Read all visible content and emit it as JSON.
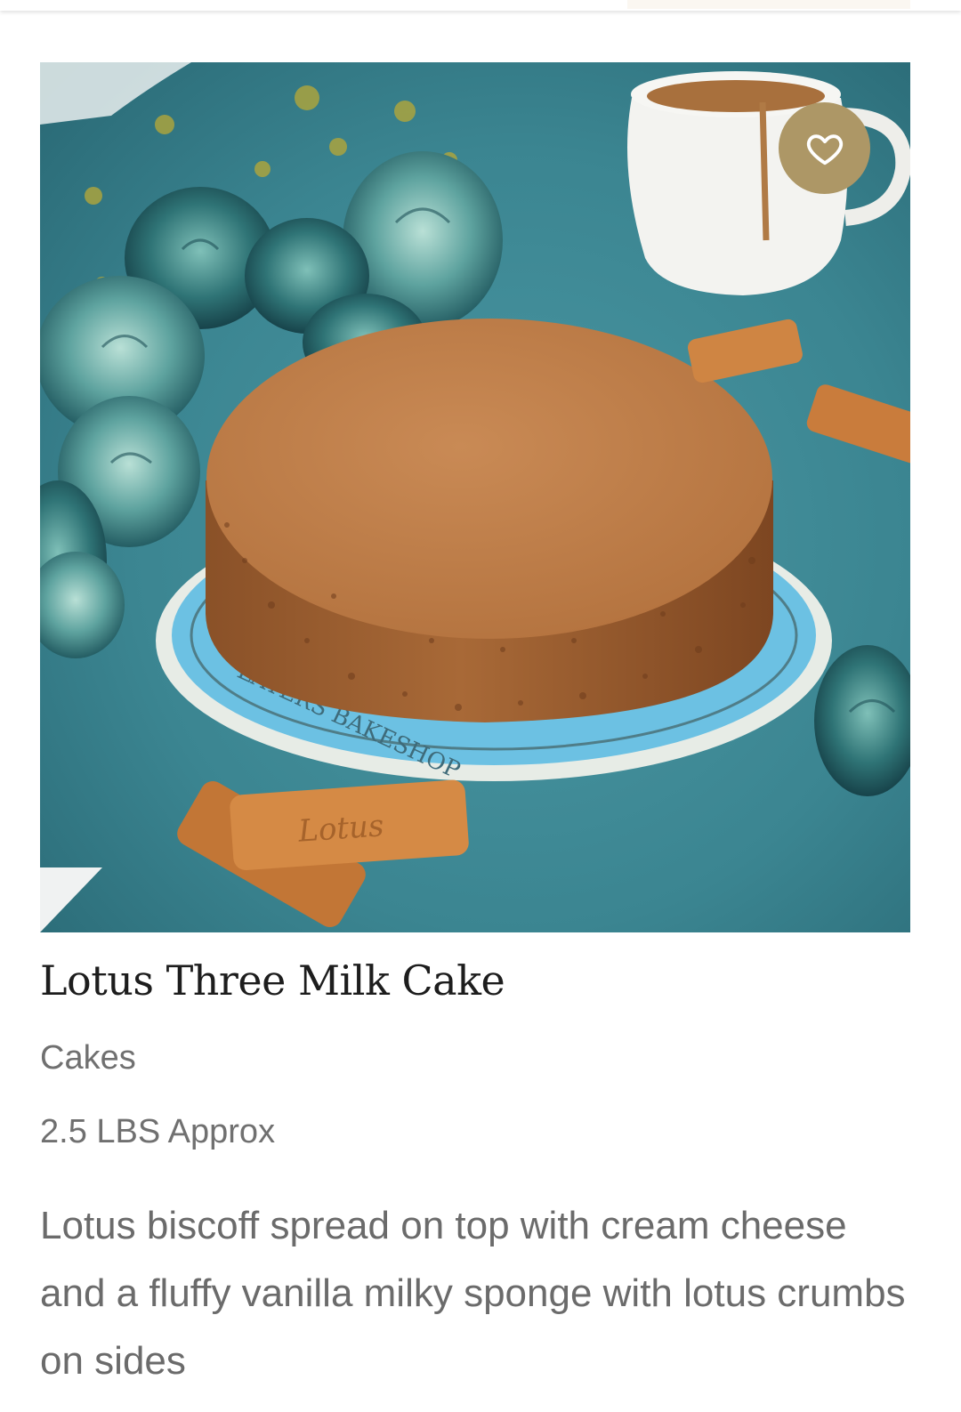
{
  "product": {
    "title": "Lotus Three Milk Cake",
    "category": "Cakes",
    "weight": "2.5 LBS Approx",
    "description": "Lotus biscoff spread on top with cream cheese and a fluffy vanilla milky sponge with lotus crumbs on sides",
    "image_alt": "Lotus Three Milk Cake",
    "plate_text": "LAYERS BAKESHOP",
    "biscuit_text": "Lotus"
  },
  "icons": {
    "favorite": "heart-outline-icon"
  },
  "colors": {
    "favorite_button": "#ad9766",
    "title": "#1d1d1d",
    "meta_text": "#707070",
    "description_text": "#6b6b6b",
    "image_background": "#3e8a96"
  }
}
